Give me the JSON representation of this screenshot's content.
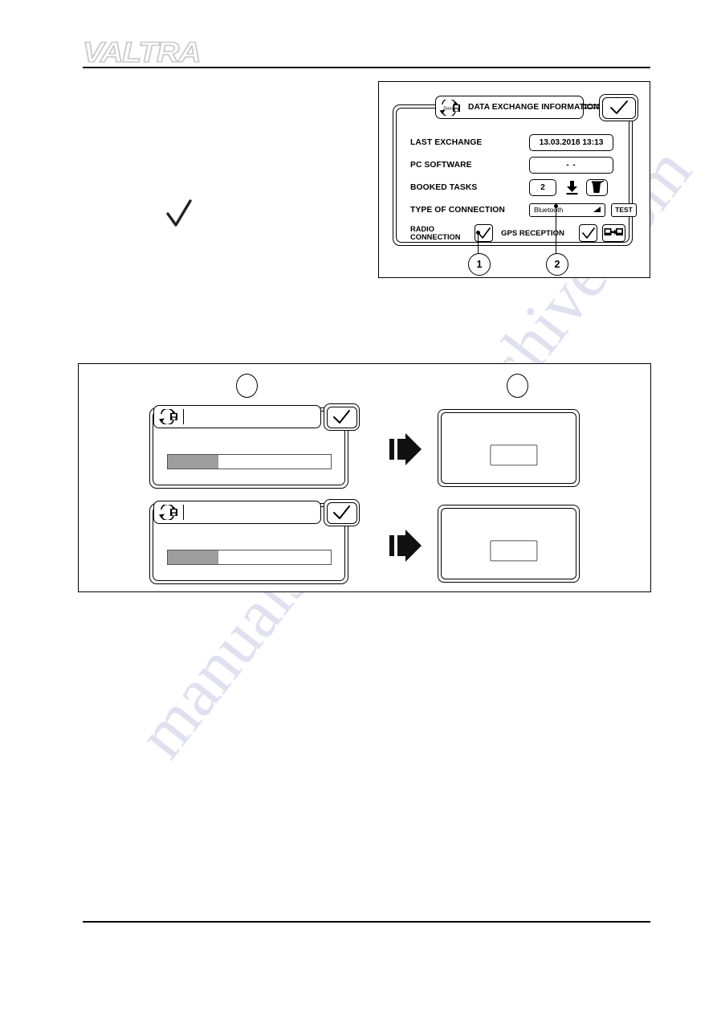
{
  "brand": {
    "logo_text": "VALTRA"
  },
  "figure1": {
    "dialog": {
      "title": "DATA EXCHANGE INFORMATION",
      "header_icon": "data-exchange-icon",
      "header_icon_text": "Data",
      "confirm_icon": "checkmark-icon",
      "rows": [
        {
          "label": "LAST EXCHANGE",
          "value": "13.03.2018  13:13"
        },
        {
          "label": "PC SOFTWARE",
          "value": "- -"
        },
        {
          "label": "BOOKED TASKS",
          "value": "2",
          "download_icon": "download-icon",
          "delete_icon": "trash-icon"
        },
        {
          "label": "TYPE OF CONNECTION",
          "value": "Bluetooth",
          "dropdown_icon": "chevron-down-icon",
          "test_label": "TEST"
        }
      ],
      "radio_label": "RADIO\nCONNECTION",
      "radio_checked_icon": "checkmark-icon",
      "gps_label": "GPS RECEPTION",
      "gps_checked_icon": "checkmark-icon",
      "network_icon": "network-transfer-icon"
    },
    "callouts": [
      {
        "number": "1"
      },
      {
        "number": "2"
      }
    ]
  },
  "figure2": {
    "step_markers": [
      {
        "number": ""
      },
      {
        "number": ""
      }
    ],
    "flows": [
      {
        "progress_dialog": {
          "header_icon": "data-exchange-icon",
          "confirm_icon": "checkmark-icon",
          "progress_percent": 31
        },
        "arrow_icon": "arrow-right-icon",
        "result_dialog": {
          "inner_box": ""
        }
      },
      {
        "progress_dialog": {
          "header_icon": "data-exchange-icon",
          "confirm_icon": "checkmark-icon",
          "progress_percent": 31
        },
        "arrow_icon": "arrow-right-icon",
        "result_dialog": {
          "inner_box": ""
        }
      }
    ]
  },
  "body_copy": {
    "tick_icon": "checkmark-icon"
  },
  "watermark": {
    "line_a": "manualshive.co",
    "line_b": "manualshive.com"
  },
  "colors": {
    "ink": "#000000",
    "logo_outline": "#c9c9cf",
    "progress_fill": "#9d9d9d",
    "watermark": "#c9c7e6"
  }
}
